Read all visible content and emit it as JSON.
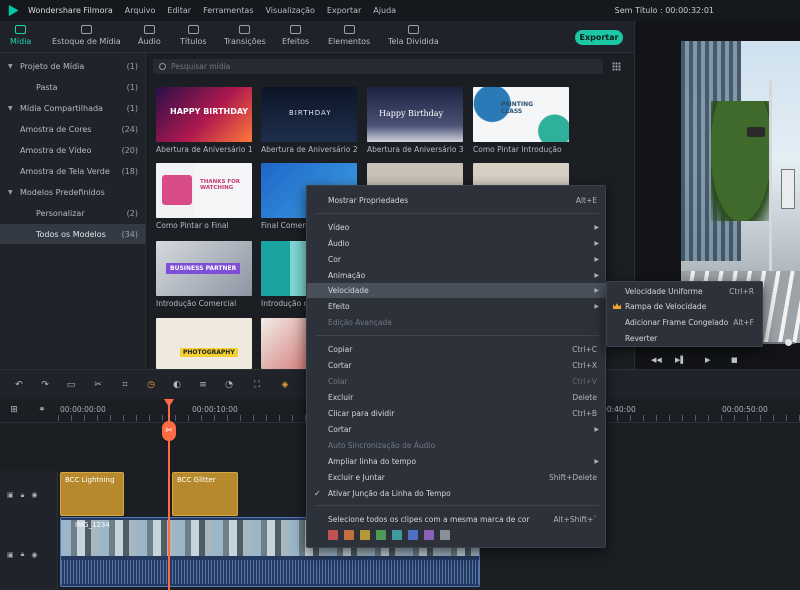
{
  "titlebar": {
    "app_name": "Wondershare Filmora",
    "menus": [
      "Arquivo",
      "Editar",
      "Ferramentas",
      "Visualização",
      "Exportar",
      "Ajuda"
    ],
    "project_title": "Sem Título : 00:00:32:01"
  },
  "toolbar": {
    "tabs": [
      "Mídia",
      "Estoque de Mídia",
      "Áudio",
      "Títulos",
      "Transições",
      "Efeitos",
      "Elementos",
      "Tela Dividida"
    ],
    "active_tab": "Mídia",
    "export_label": "Exportar",
    "accent_color": "#1dd4b2"
  },
  "sidebar": {
    "items": [
      {
        "label": "Projeto de Mídia",
        "count": "(1)",
        "expandable": true
      },
      {
        "label": "Pasta",
        "count": "(1)",
        "expandable": false
      },
      {
        "label": "Mídia Compartilhada",
        "count": "(1)",
        "expandable": true
      },
      {
        "label": "Amostra de Cores",
        "count": "(24)",
        "expandable": false
      },
      {
        "label": "Amostra de Vídeo",
        "count": "(20)",
        "expandable": false
      },
      {
        "label": "Amostra de Tela Verde",
        "count": "(18)",
        "expandable": false
      },
      {
        "label": "Modelos Predefinidos",
        "count": "",
        "expandable": true
      },
      {
        "label": "Personalizar",
        "count": "(2)",
        "expandable": false
      },
      {
        "label": "Todos os Modelos",
        "count": "(34)",
        "expandable": false,
        "selected": true
      }
    ]
  },
  "media": {
    "search_placeholder": "Pesquisar mídia",
    "items": [
      {
        "label": "Abertura de Aniversário 1",
        "thumb_text": "HAPPY BIRTHDAY"
      },
      {
        "label": "Abertura de Aniversário 2",
        "thumb_text": "BIRTHDAY"
      },
      {
        "label": "Abertura de Aniversário 3",
        "thumb_text": "Happy Birthday"
      },
      {
        "label": "Como Pintar Introdução",
        "thumb_text": "PAINTING CLASS"
      },
      {
        "label": "Como Pintar o Final",
        "thumb_text": "THANKS FOR WATCHING"
      },
      {
        "label": "Final Comercial",
        "thumb_text": ""
      },
      {
        "label": "",
        "thumb_text": ""
      },
      {
        "label": "",
        "thumb_text": ""
      },
      {
        "label": "Introdução Comercial",
        "thumb_text": "BUSINESS PARTNER"
      },
      {
        "label": "Introdução de Viagem",
        "thumb_text": ""
      },
      {
        "label": "",
        "thumb_text": "PHOTOGRAPHY"
      },
      {
        "label": "",
        "thumb_text": ""
      }
    ]
  },
  "timeline": {
    "ruler_labels": [
      "00:00:00:00",
      "00:00:10:00",
      "00:00:40:00",
      "00:00:50:00"
    ],
    "effect_clips": [
      "BCC Lightning",
      "BCC Glitter"
    ],
    "video_clip_label": "IMG_1234"
  },
  "context_menu": {
    "items": [
      {
        "label": "Mostrar Propriedades",
        "shortcut": "Alt+E"
      },
      {
        "label": "Vídeo",
        "submenu": true
      },
      {
        "label": "Áudio",
        "submenu": true
      },
      {
        "label": "Cor",
        "submenu": true
      },
      {
        "label": "Animação",
        "submenu": true
      },
      {
        "label": "Velocidade",
        "submenu": true,
        "highlighted": true
      },
      {
        "label": "Efeito",
        "submenu": true
      },
      {
        "label": "Edição Avançada",
        "disabled": true
      },
      {
        "label": "Copiar",
        "shortcut": "Ctrl+C"
      },
      {
        "label": "Cortar",
        "shortcut": "Ctrl+X"
      },
      {
        "label": "Colar",
        "shortcut": "Ctrl+V",
        "disabled": true
      },
      {
        "label": "Excluir",
        "shortcut": "Delete"
      },
      {
        "label": "Clicar para dividir",
        "shortcut": "Ctrl+B"
      },
      {
        "label": "Cortar",
        "submenu": true
      },
      {
        "label": "Auto Sincronização de Áudio",
        "disabled": true
      },
      {
        "label": "Ampliar linha do tempo",
        "submenu": true
      },
      {
        "label": "Excluir e Juntar",
        "shortcut": "Shift+Delete"
      },
      {
        "label": "Ativar Junção da Linha do Tempo",
        "checked": true
      },
      {
        "label": "Selecione todos os clipes com a mesma marca de cor",
        "shortcut": "Alt+Shift+`"
      }
    ],
    "color_marks": [
      "#c25353",
      "#c2703e",
      "#b29a3a",
      "#4f9a57",
      "#3f9aa0",
      "#4e6fc4",
      "#8a62b8",
      "#8b8f96"
    ]
  },
  "speed_submenu": {
    "items": [
      {
        "label": "Velocidade Uniforme",
        "shortcut": "Ctrl+R"
      },
      {
        "label": "Rampa de Velocidade",
        "shortcut": "",
        "premium": true
      },
      {
        "label": "Adicionar Frame Congelado",
        "shortcut": "Alt+F"
      },
      {
        "label": "Reverter",
        "shortcut": ""
      }
    ]
  }
}
